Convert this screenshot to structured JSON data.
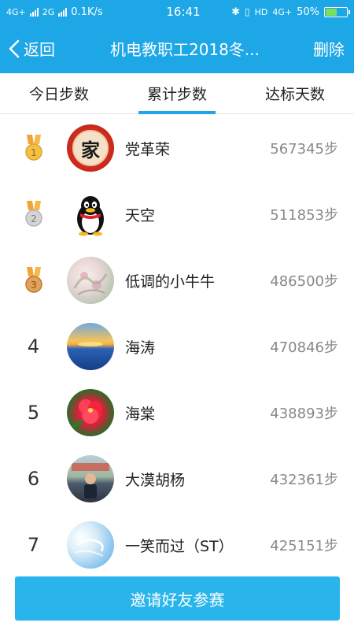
{
  "status_bar": {
    "network_1": "4G+",
    "network_2": "2G",
    "speed": "0.1K/s",
    "time": "16:41",
    "hd_label": "HD",
    "network_3": "4G+",
    "battery_percent": "50%",
    "battery_level": 0.5
  },
  "header": {
    "back_label": "返回",
    "title": "机电教职工2018冬...",
    "delete_label": "删除"
  },
  "tabs": [
    {
      "label": "今日步数",
      "active": false
    },
    {
      "label": "累计步数",
      "active": true
    },
    {
      "label": "达标天数",
      "active": false
    }
  ],
  "leaderboard": [
    {
      "rank": "1",
      "medal": true,
      "name": "党革荣",
      "steps": "567345步",
      "avatar": "jia-character-avatar",
      "avatar_text": "家"
    },
    {
      "rank": "2",
      "medal": true,
      "name": "天空",
      "steps": "511853步",
      "avatar": "penguin-avatar"
    },
    {
      "rank": "3",
      "medal": true,
      "name": "低调的小牛牛",
      "steps": "486500步",
      "avatar": "painting-avatar"
    },
    {
      "rank": "4",
      "medal": false,
      "name": "海涛",
      "steps": "470846步",
      "avatar": "sunset-sea-avatar"
    },
    {
      "rank": "5",
      "medal": false,
      "name": "海棠",
      "steps": "438893步",
      "avatar": "red-flower-avatar"
    },
    {
      "rank": "6",
      "medal": false,
      "name": "大漠胡杨",
      "steps": "432361步",
      "avatar": "child-photo-avatar"
    },
    {
      "rank": "7",
      "medal": false,
      "name": "一笑而过（ST）",
      "steps": "425151步",
      "avatar": "sky-cloud-avatar"
    }
  ],
  "invite_button_label": "邀请好友参赛",
  "colors": {
    "primary": "#1ea7e6",
    "button": "#29b5ec",
    "medal_ribbon": "#f0a33a",
    "gold": "#f3c244",
    "silver": "#c9c9c9",
    "bronze": "#d9964a"
  }
}
